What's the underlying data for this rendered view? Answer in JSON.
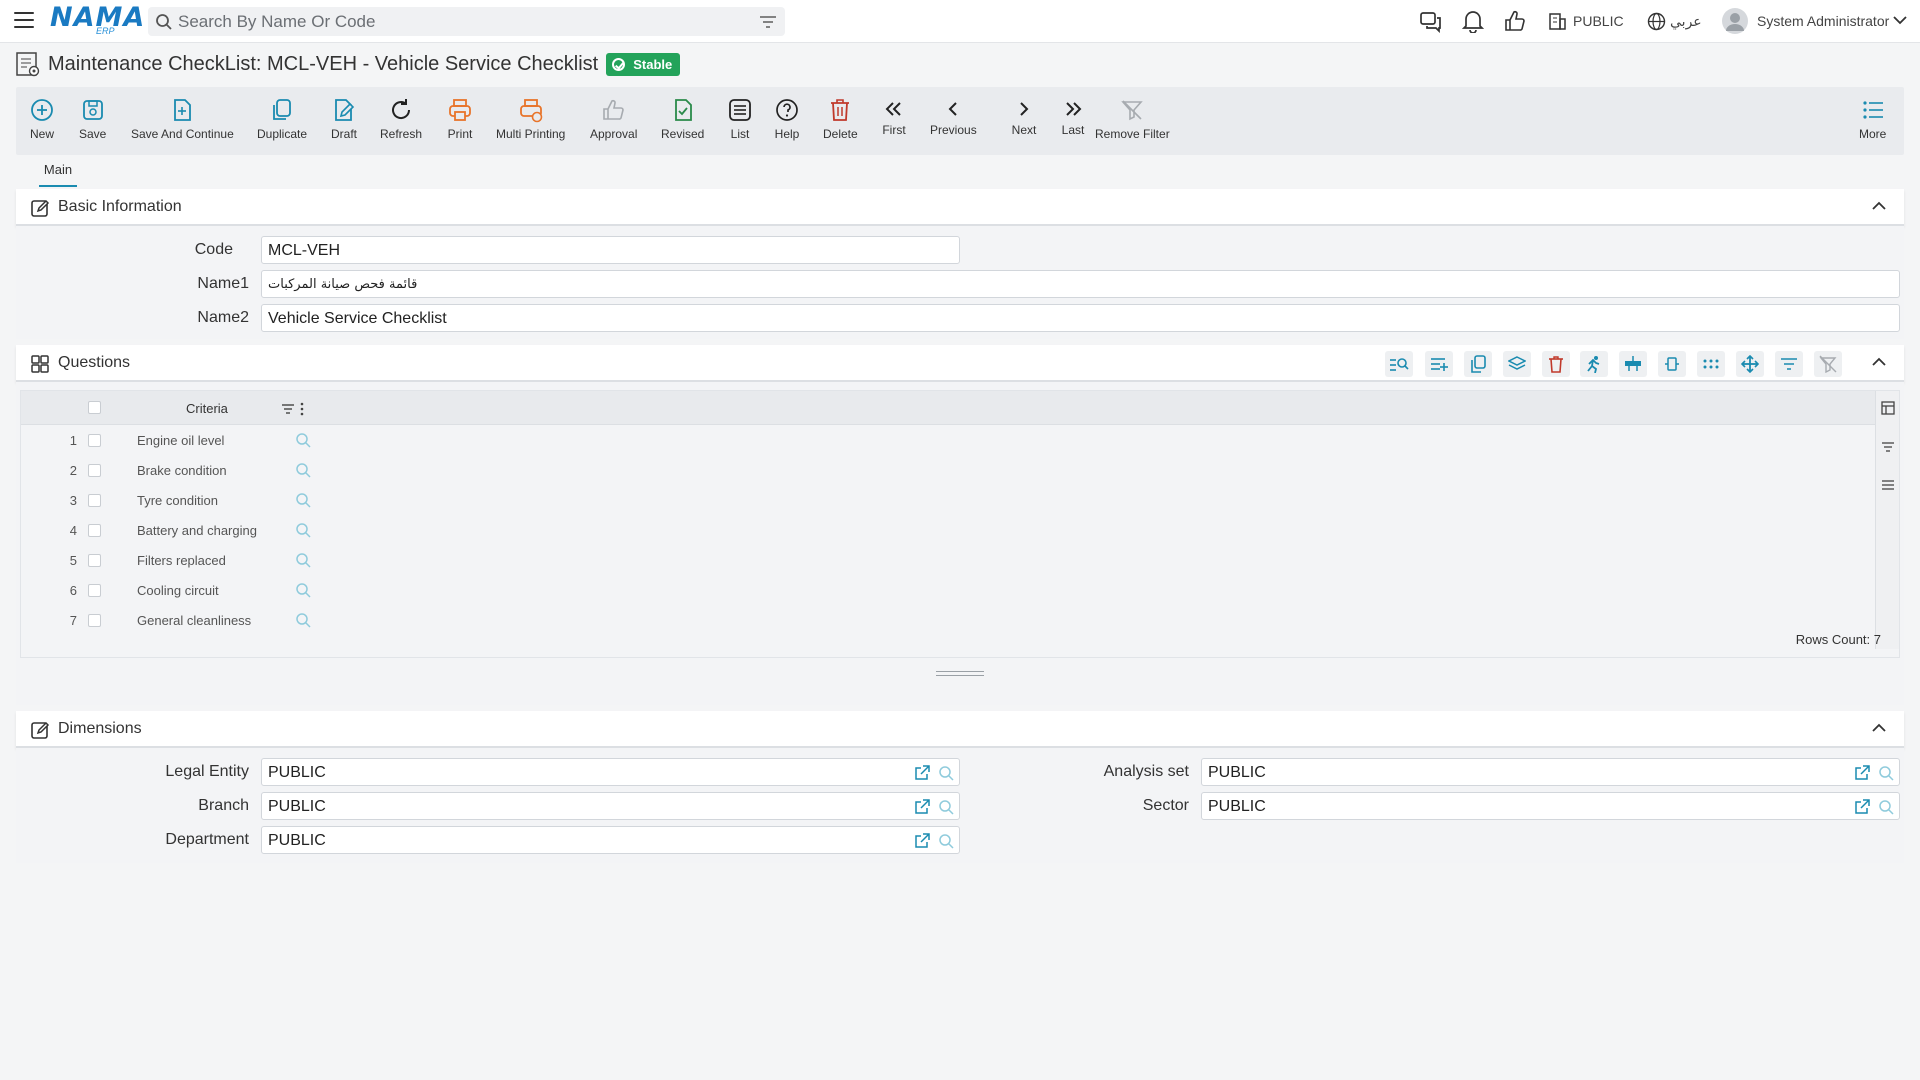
{
  "topbar": {
    "logo": "NAMA",
    "logo_sub": "ERP",
    "search_placeholder": "Search By Name Or Code",
    "company": "PUBLIC",
    "language": "عربي",
    "user": "System Administrator"
  },
  "page": {
    "title": "Maintenance CheckList: MCL-VEH - Vehicle Service Checklist",
    "status": "Stable"
  },
  "toolbar": {
    "new": "New",
    "save": "Save",
    "save_continue": "Save And Continue",
    "duplicate": "Duplicate",
    "draft": "Draft",
    "refresh": "Refresh",
    "print": "Print",
    "multi_printing": "Multi Printing",
    "approval": "Approval",
    "revised": "Revised",
    "list": "List",
    "help": "Help",
    "delete": "Delete",
    "first": "First",
    "previous": "Previous",
    "next": "Next",
    "last": "Last",
    "remove_filter": "Remove Filter",
    "more": "More"
  },
  "tabs": {
    "main": "Main"
  },
  "basic": {
    "title": "Basic Information",
    "code_label": "Code",
    "code": "MCL-VEH",
    "name1_label": "Name1",
    "name1": "قائمة فحص صيانة المركبات",
    "name2_label": "Name2",
    "name2": "Vehicle Service Checklist"
  },
  "questions": {
    "title": "Questions",
    "column": "Criteria",
    "rows": [
      {
        "n": "1",
        "text": "Engine oil level"
      },
      {
        "n": "2",
        "text": "Brake condition"
      },
      {
        "n": "3",
        "text": "Tyre condition"
      },
      {
        "n": "4",
        "text": "Battery and charging"
      },
      {
        "n": "5",
        "text": "Filters replaced"
      },
      {
        "n": "6",
        "text": "Cooling circuit"
      },
      {
        "n": "7",
        "text": "General cleanliness"
      }
    ],
    "rows_count": "Rows Count: 7"
  },
  "dimensions": {
    "title": "Dimensions",
    "legal_entity_label": "Legal Entity",
    "legal_entity": "PUBLIC",
    "branch_label": "Branch",
    "branch": "PUBLIC",
    "department_label": "Department",
    "department": "PUBLIC",
    "analysis_set_label": "Analysis set",
    "analysis_set": "PUBLIC",
    "sector_label": "Sector",
    "sector": "PUBLIC"
  },
  "colors": {
    "brand": "#1a7ac2",
    "accent": "#1a8bb0",
    "stable": "#23a35a",
    "print": "#e8742a",
    "delete": "#c0392b"
  }
}
